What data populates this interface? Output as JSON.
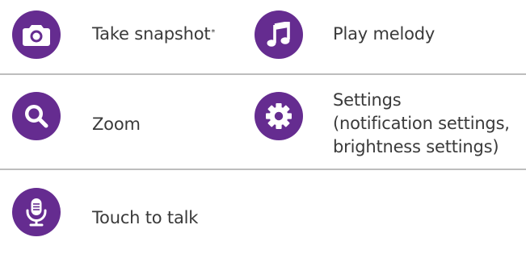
{
  "colors": {
    "icon_bg": "#652c90",
    "icon_fg": "#ffffff",
    "text": "#3a3a3a",
    "divider": "#bdbdbd"
  },
  "items": [
    {
      "icon": "camera-icon",
      "label": "Take snapshot",
      "footnote_mark": "*"
    },
    {
      "icon": "music-note-icon",
      "label": "Play melody"
    },
    {
      "icon": "magnifier-icon",
      "label": "Zoom"
    },
    {
      "icon": "gear-icon",
      "label_lines": [
        "Settings",
        "(notification settings,",
        "brightness settings)"
      ]
    },
    {
      "icon": "microphone-icon",
      "label": "Touch to talk"
    }
  ]
}
